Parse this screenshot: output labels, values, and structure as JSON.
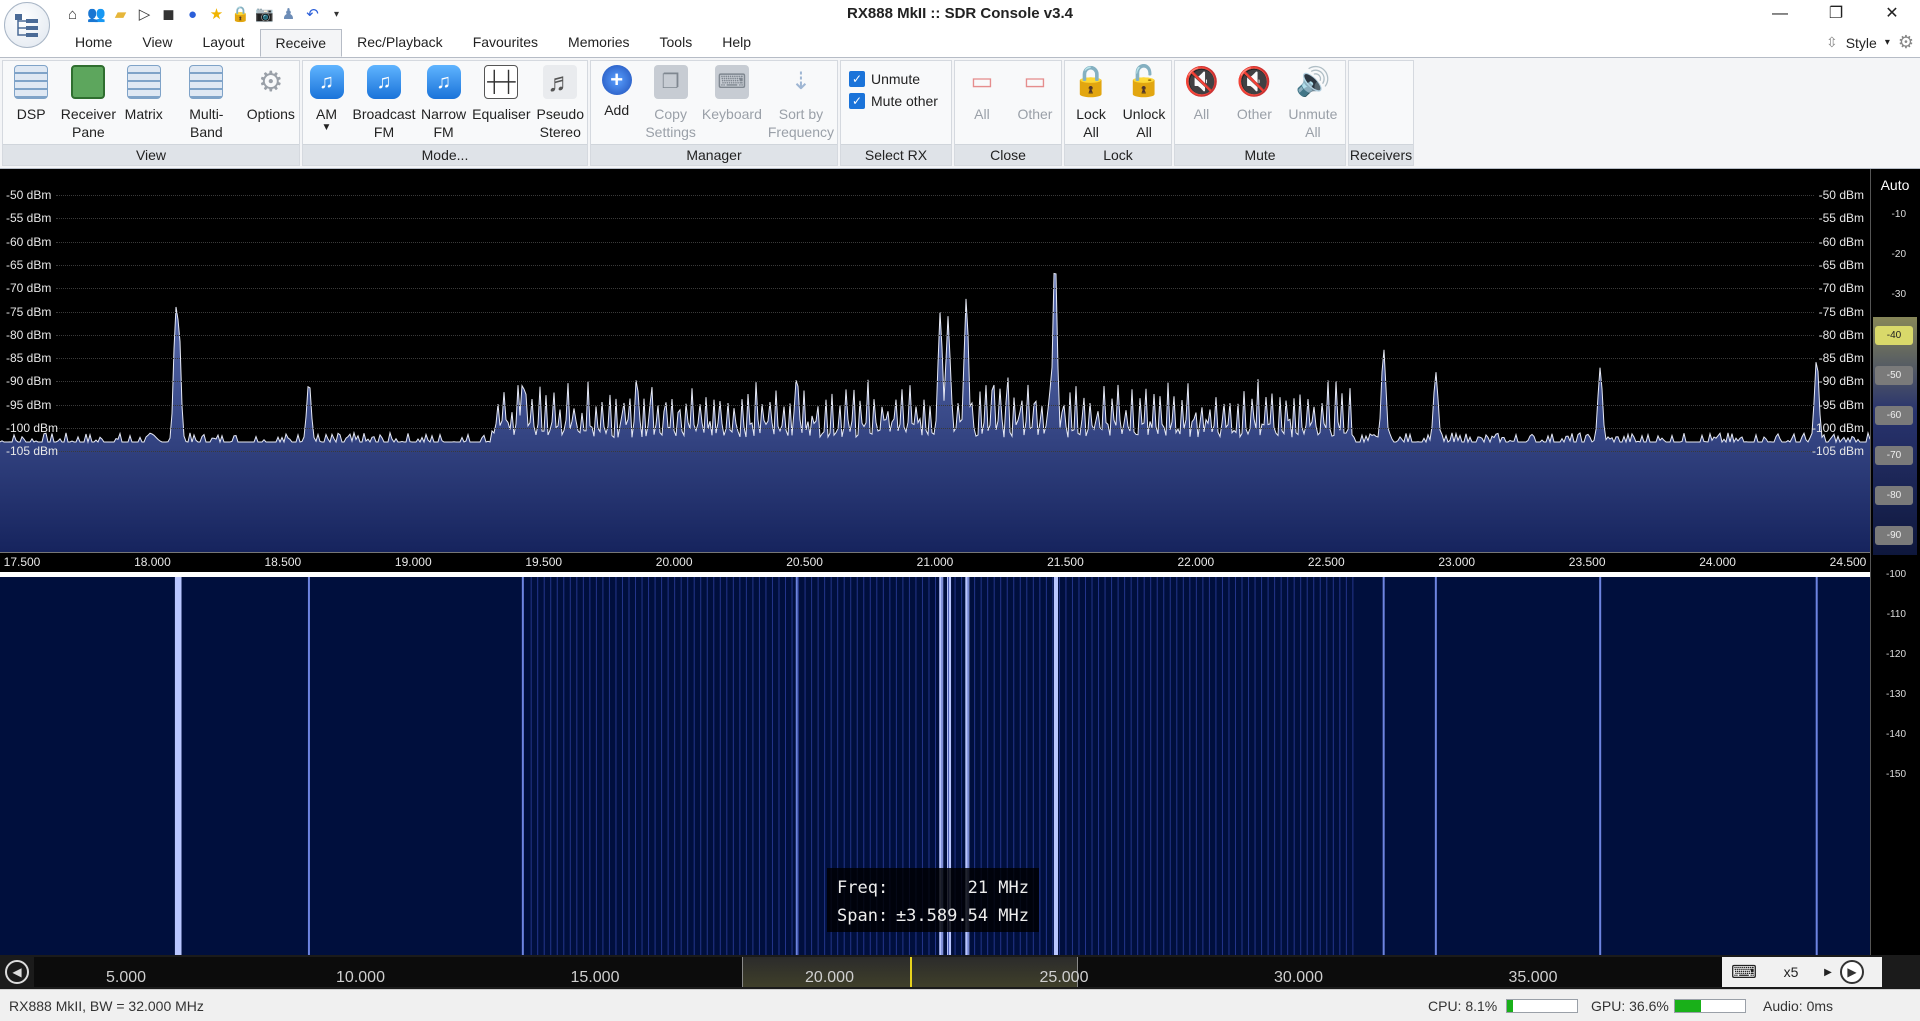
{
  "window": {
    "title": "RX888 MkII :: SDR Console v3.4",
    "controls": [
      "—",
      "❐",
      "✕"
    ]
  },
  "quick_access": [
    "home-icon",
    "users-icon",
    "folder-icon",
    "play-icon",
    "stop-icon",
    "record-icon",
    "star-icon",
    "lock-icon",
    "camera-icon",
    "person-icon",
    "undo-icon",
    "dropdown-icon"
  ],
  "menu": {
    "items": [
      "Home",
      "View",
      "Layout",
      "Receive",
      "Rec/Playback",
      "Favourites",
      "Memories",
      "Tools",
      "Help"
    ],
    "active": "Receive",
    "style_label": "Style"
  },
  "ribbon": {
    "view": {
      "label": "View",
      "buttons": [
        "DSP",
        "Receiver Pane",
        "Matrix",
        "Multi-Band",
        "Options"
      ]
    },
    "mode": {
      "label": "Mode...",
      "buttons": [
        "AM",
        "Broadcast FM",
        "Narrow FM",
        "Equaliser",
        "Pseudo Stereo"
      ]
    },
    "manager": {
      "label": "Manager",
      "buttons": [
        "Add",
        "Copy Settings",
        "Keyboard",
        "Sort by Frequency"
      ]
    },
    "select_rx": {
      "label": "Select RX",
      "unmute": "Unmute",
      "mute_other": "Mute other"
    },
    "close": {
      "label": "Close",
      "buttons": [
        "All",
        "Other"
      ]
    },
    "lock": {
      "label": "Lock",
      "buttons": [
        "Lock All",
        "Unlock All"
      ]
    },
    "mute": {
      "label": "Mute",
      "buttons": [
        "All",
        "Other",
        "Unmute All"
      ]
    },
    "receivers": {
      "label": "Receivers"
    }
  },
  "spectrum": {
    "dbm_labels": [
      "-50 dBm",
      "-55 dBm",
      "-60 dBm",
      "-65 dBm",
      "-70 dBm",
      "-75 dBm",
      "-80 dBm",
      "-85 dBm",
      "-90 dBm",
      "-95 dBm",
      "-100 dBm",
      "-105 dBm"
    ],
    "freq_labels": [
      "17.500",
      "18.000",
      "18.500",
      "19.000",
      "19.500",
      "20.000",
      "20.500",
      "21.000",
      "21.500",
      "22.000",
      "22.500",
      "23.000",
      "23.500",
      "24.000",
      "24.500"
    ],
    "peaks": [
      {
        "freq": 18.09,
        "dbm": -74
      },
      {
        "freq": 18.1,
        "dbm": -76
      },
      {
        "freq": 18.6,
        "dbm": -90
      },
      {
        "freq": 19.42,
        "dbm": -90
      },
      {
        "freq": 20.47,
        "dbm": -89
      },
      {
        "freq": 21.02,
        "dbm": -75
      },
      {
        "freq": 21.05,
        "dbm": -76
      },
      {
        "freq": 21.12,
        "dbm": -72
      },
      {
        "freq": 21.46,
        "dbm": -63
      },
      {
        "freq": 22.72,
        "dbm": -83
      },
      {
        "freq": 22.92,
        "dbm": -88
      },
      {
        "freq": 23.55,
        "dbm": -87
      },
      {
        "freq": 24.38,
        "dbm": -85
      }
    ],
    "noise_floor_dbm": -103
  },
  "waterfall": {
    "tooltip": {
      "freq_label": "Freq:",
      "freq_value": "21 MHz",
      "span_label": "Span:",
      "span_value": "±3.589.54 MHz"
    }
  },
  "scale": {
    "auto_label": "Auto",
    "ticks": [
      "-10",
      "-20",
      "-30",
      "-40",
      "-50",
      "-60",
      "-70",
      "-80",
      "-90",
      "-100",
      "-110",
      "-120",
      "-130",
      "-140",
      "-150"
    ]
  },
  "overview": {
    "labels": [
      "5.000",
      "10.000",
      "15.000",
      "20.000",
      "25.000",
      "30.000",
      "35.000"
    ],
    "zoom": "x5"
  },
  "status": {
    "device": "RX888 MkII, BW = 32.000 MHz",
    "cpu": "CPU: 8.1%",
    "cpu_fraction": 0.081,
    "gpu": "GPU: 36.6%",
    "gpu_fraction": 0.366,
    "audio": "Audio: 0ms"
  }
}
